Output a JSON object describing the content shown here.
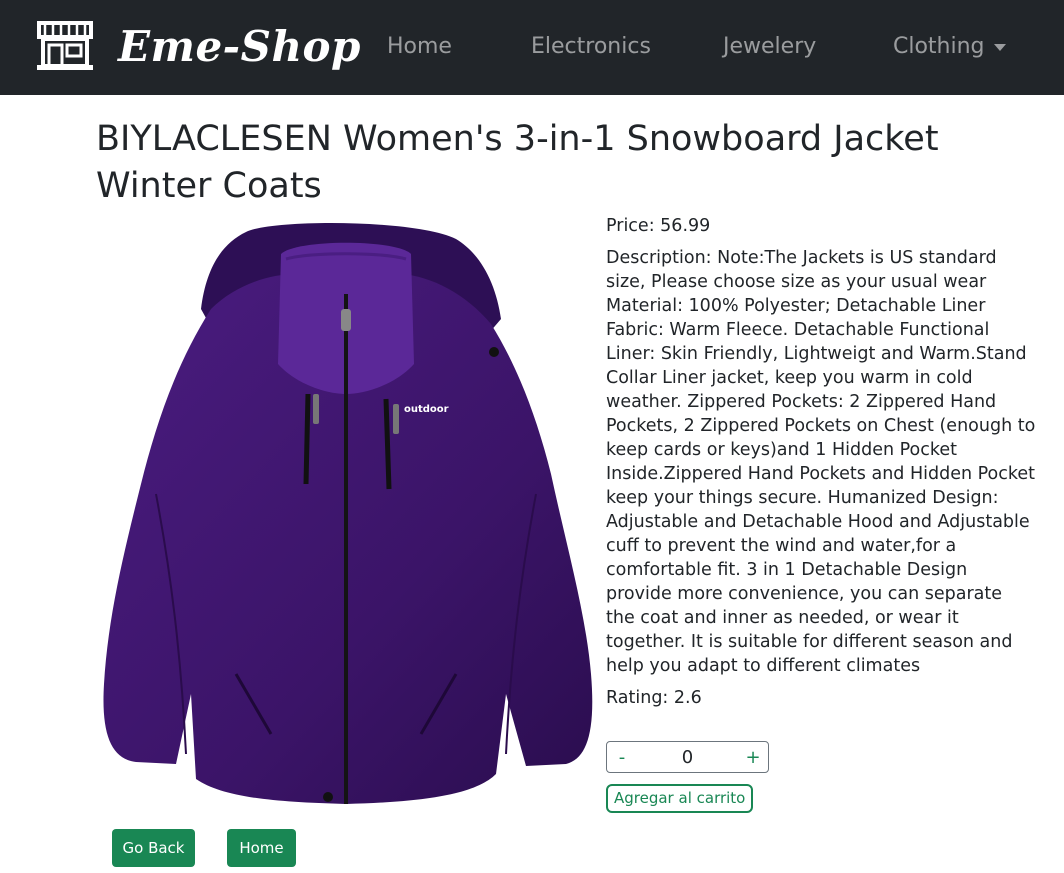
{
  "navbar": {
    "brand_name": "Eme-Shop",
    "brand_icon": "store-icon",
    "links": [
      "Home",
      "Electronics",
      "Jewelery",
      "Clothing"
    ],
    "colors": {
      "background": "#212529",
      "link": "rgba(255,255,255,0.55)"
    }
  },
  "product": {
    "title": "BIYLACLESEN Women's 3-in-1 Snowboard Jacket Winter Coats",
    "image_label": "outdoor",
    "price_label": "Price:",
    "price": "56.99",
    "description_label": "Description:",
    "description": "Note:The Jackets is US standard size, Please choose size as your usual wear Material: 100% Polyester; Detachable Liner Fabric: Warm Fleece. Detachable Functional Liner: Skin Friendly, Lightweigt and Warm.Stand Collar Liner jacket, keep you warm in cold weather. Zippered Pockets: 2 Zippered Hand Pockets, 2 Zippered Pockets on Chest (enough to keep cards or keys)and 1 Hidden Pocket Inside.Zippered Hand Pockets and Hidden Pocket keep your things secure. Humanized Design: Adjustable and Detachable Hood and Adjustable cuff to prevent the wind and water,for a comfortable fit. 3 in 1 Detachable Design provide more convenience, you can separate the coat and inner as needed, or wear it together. It is suitable for different season and help you adapt to different climates",
    "rating_label": "Rating:",
    "rating": "2.6"
  },
  "quantity": {
    "minus": "-",
    "value": "0",
    "plus": "+"
  },
  "buttons": {
    "add_to_cart": "Agregar al carrito",
    "go_back": "Go Back",
    "home": "Home"
  },
  "colors": {
    "accent": "#198754",
    "jacket": "#3f1670"
  }
}
